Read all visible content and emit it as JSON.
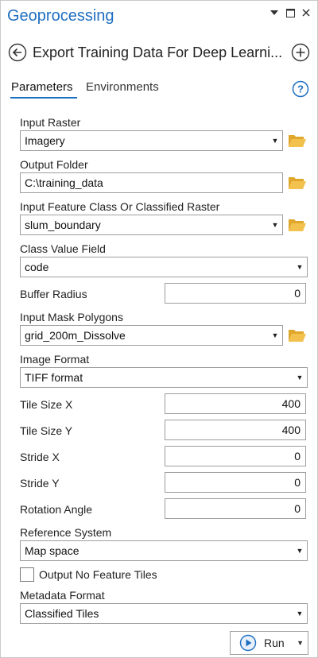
{
  "pane": {
    "title": "Geoprocessing",
    "menu_icon": "caret-down-icon",
    "restore_icon": "restore-icon",
    "close_icon": "close-icon"
  },
  "tool": {
    "title": "Export Training Data For Deep Learni...",
    "back_icon": "back-arrow-icon",
    "add_icon": "add-circle-icon"
  },
  "tabs": {
    "parameters": "Parameters",
    "environments": "Environments",
    "active": "parameters",
    "help_icon": "help-icon"
  },
  "fields": {
    "input_raster": {
      "label": "Input Raster",
      "value": "Imagery"
    },
    "output_folder": {
      "label": "Output Folder",
      "value": "C:\\training_data"
    },
    "input_feature_class": {
      "label": "Input Feature Class Or Classified Raster",
      "value": "slum_boundary"
    },
    "class_value_field": {
      "label": "Class Value Field",
      "value": "code"
    },
    "buffer_radius": {
      "label": "Buffer Radius",
      "value": "0"
    },
    "input_mask_polygons": {
      "label": "Input Mask Polygons",
      "value": "grid_200m_Dissolve"
    },
    "image_format": {
      "label": "Image Format",
      "value": "TIFF format"
    },
    "tile_size_x": {
      "label": "Tile Size X",
      "value": "400"
    },
    "tile_size_y": {
      "label": "Tile Size Y",
      "value": "400"
    },
    "stride_x": {
      "label": "Stride X",
      "value": "0"
    },
    "stride_y": {
      "label": "Stride Y",
      "value": "0"
    },
    "rotation_angle": {
      "label": "Rotation Angle",
      "value": "0"
    },
    "reference_system": {
      "label": "Reference System",
      "value": "Map space"
    },
    "output_no_feature_tiles": {
      "label": "Output No Feature Tiles",
      "checked": false
    },
    "metadata_format": {
      "label": "Metadata Format",
      "value": "Classified Tiles"
    }
  },
  "run": {
    "label": "Run"
  },
  "colors": {
    "accent": "#1f6fc1",
    "folder": "#e8b335",
    "border": "#9e9e9e"
  }
}
